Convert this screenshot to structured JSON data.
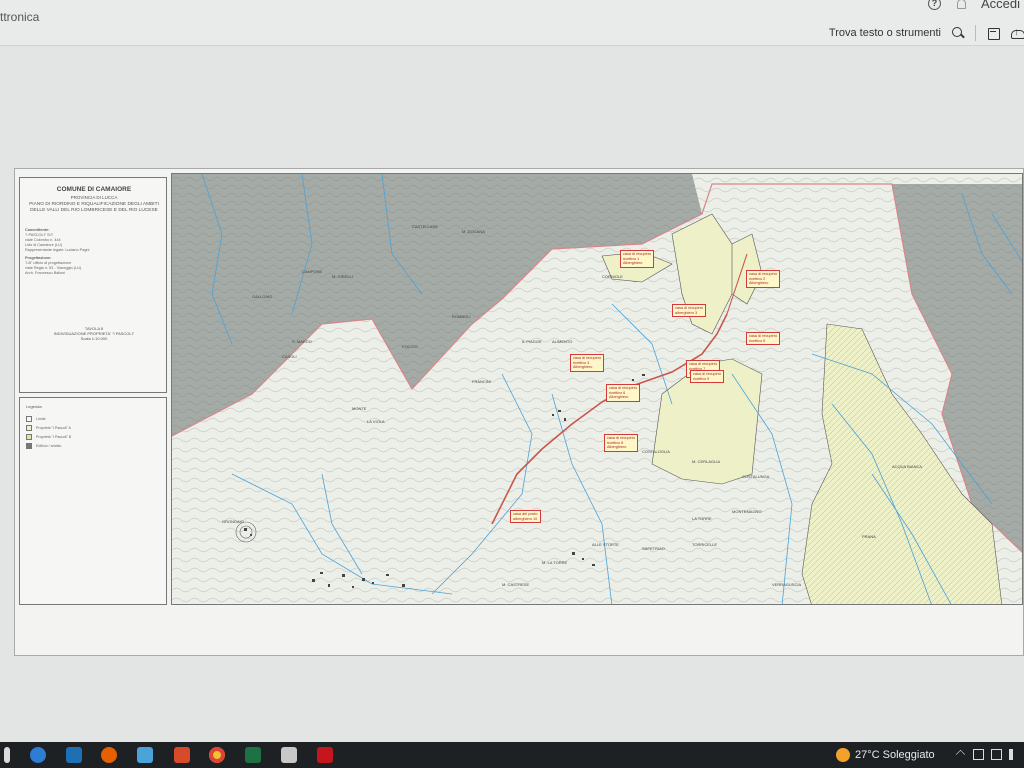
{
  "header": {
    "app_title": "ttronica",
    "signin_label": "Accedi",
    "help_icon_glyph": "?"
  },
  "toolbar": {
    "find_label": "Trova testo o strumenti"
  },
  "document": {
    "legend": {
      "comune": "COMUNE DI CAMAIORE",
      "provincia": "PROVINCIA DI LUCCA",
      "plan_lines": [
        "PIANO DI RIORDINO E RIQUALIFICAZIONE DEGLI AMBITI",
        "DELLE VALLI DEL RIO LOMBRICESE E DEL RIO LUCESE"
      ],
      "committente": [
        "Committente:",
        "\"I PASCOLI\" SrT",
        "viale Colombo n. 444",
        "Lido di Camaiore (LU)",
        "Rappresentante legale: Luciano Pagni"
      ],
      "progettazione": [
        "Progettazione:",
        "\"LB\" ufficio di progettazione",
        "viale Regia n. 53 - Viareggio (LU)",
        "Arch. Francesco Balloni"
      ],
      "tavola": [
        "TAVOLA 8",
        "INDIVIDUAZIONE PROPRIETA' \"I PASCOLI\"",
        "Scala 1:10.000"
      ],
      "legend_title": "Legenda",
      "legend_items": [
        "Limite",
        "Proprietà \"I Pascoli\" A",
        "Proprietà \"I Pascoli\" B",
        "Edificio / ambito"
      ]
    },
    "map_labels": [
      "CASTELLARE",
      "M. DOGANA",
      "M. GIRELLI",
      "GALLOAIO",
      "S. MARCO",
      "FOCCIO",
      "IL PIAGGE",
      "FRANCINI",
      "COSTALOGLIA",
      "LA VIOLA",
      "CORNIOLE",
      "ROMBOLI",
      "CAMPONE",
      "ALIMENTO",
      "MONTE",
      "CASOLI",
      "GRONDAIO",
      "M. LA TORRE",
      "M. CASTRESE",
      "ALLE STORTE",
      "SAPETRIAO",
      "PRANA",
      "M. CERLAGLIA",
      "LA TORRE",
      "MONTEMAGNO",
      "TORRICELLE",
      "COSTALUNGA",
      "ACQUA BIANCA",
      "VERRAGUSCIA"
    ],
    "red_labels": [
      "casa di recupero\nricettivo 1\nAlberghiero",
      "casa di recupero\nricettivo 2\nAlberghiero",
      "casa di recupero\nalberghiero 3",
      "casa di recupero\nricettivo 4\nAlberghiero",
      "casa di recupero\nricettivo 5",
      "casa di recupero\nricettivo 6\nAlberghiero",
      "casa di recupero\nricettivo 7\nAlberghiero",
      "casa di recupero\nricettivo 8\nAlberghiero",
      "casa di recupero\nricettivo 9",
      "casa del posto\nalberghiero 10"
    ]
  },
  "taskbar": {
    "weather_text": "27°C  Soleggiato",
    "colors": {
      "taskbar_bg": "#1e2124",
      "sun": "#f3a12b"
    }
  }
}
